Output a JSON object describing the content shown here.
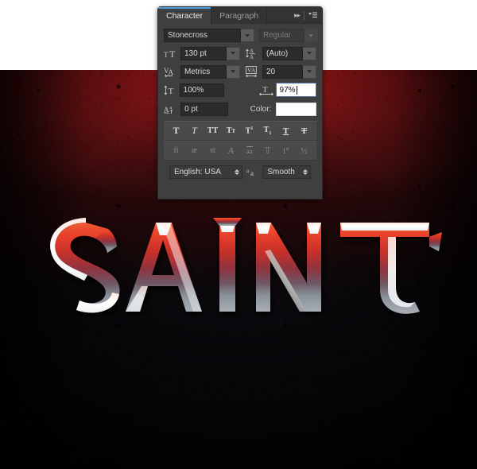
{
  "canvas": {
    "artwork_text": "SAINT",
    "background_colors": {
      "top_strip": "#ffffff",
      "red": "#8c1618",
      "dark": "#08090b"
    },
    "text_gradient": {
      "top": "#e8452a",
      "mid": "#a33038",
      "bottom": "#8e949c"
    }
  },
  "panel": {
    "tabs": [
      {
        "label": "Character",
        "active": true
      },
      {
        "label": "Paragraph",
        "active": false
      }
    ],
    "header_icons": {
      "collapse": "double-chevron-right-icon",
      "menu": "panel-menu-icon"
    },
    "font": {
      "family_value": "Stonecross",
      "style_value": "Regular",
      "style_disabled": true
    },
    "metrics": {
      "size_icon": "font-size-icon",
      "size_value": "130 pt",
      "leading_icon": "leading-icon",
      "leading_value": "(Auto)",
      "kerning_icon": "kerning-icon",
      "kerning_value": "Metrics",
      "tracking_icon": "tracking-icon",
      "tracking_value": "20"
    },
    "scale": {
      "vertical_icon": "vertical-scale-icon",
      "vertical_value": "100%",
      "horizontal_icon": "horizontal-scale-icon",
      "horizontal_value": "97%",
      "horizontal_focused": true,
      "baseline_icon": "baseline-shift-icon",
      "baseline_value": "0 pt",
      "color_label": "Color:",
      "color_value": "#ffffff"
    },
    "format_buttons_row1": [
      {
        "name": "faux-bold-button",
        "glyph": "T"
      },
      {
        "name": "faux-italic-button",
        "glyph": "T"
      },
      {
        "name": "all-caps-button",
        "glyph": "TT"
      },
      {
        "name": "small-caps-button",
        "glyph": "TT"
      },
      {
        "name": "superscript-button",
        "glyph": "T"
      },
      {
        "name": "subscript-button",
        "glyph": "T"
      },
      {
        "name": "underline-button",
        "glyph": "T"
      },
      {
        "name": "strikethrough-button",
        "glyph": "T"
      }
    ],
    "format_buttons_row2": [
      {
        "name": "standard-ligatures-button",
        "glyph": "fi"
      },
      {
        "name": "contextual-alternates-button",
        "glyph": "œ"
      },
      {
        "name": "discretionary-ligatures-button",
        "glyph": "st"
      },
      {
        "name": "swash-button",
        "glyph": "𝒜"
      },
      {
        "name": "stylistic-alternates-button",
        "glyph": "aa"
      },
      {
        "name": "titling-alternates-button",
        "glyph": "T"
      },
      {
        "name": "ordinals-button",
        "glyph": "1st"
      },
      {
        "name": "fractions-button",
        "glyph": "½"
      }
    ],
    "bottom": {
      "language_value": "English: USA",
      "antialias_icon": "anti-aliasing-icon",
      "antialias_value": "Smooth"
    }
  }
}
